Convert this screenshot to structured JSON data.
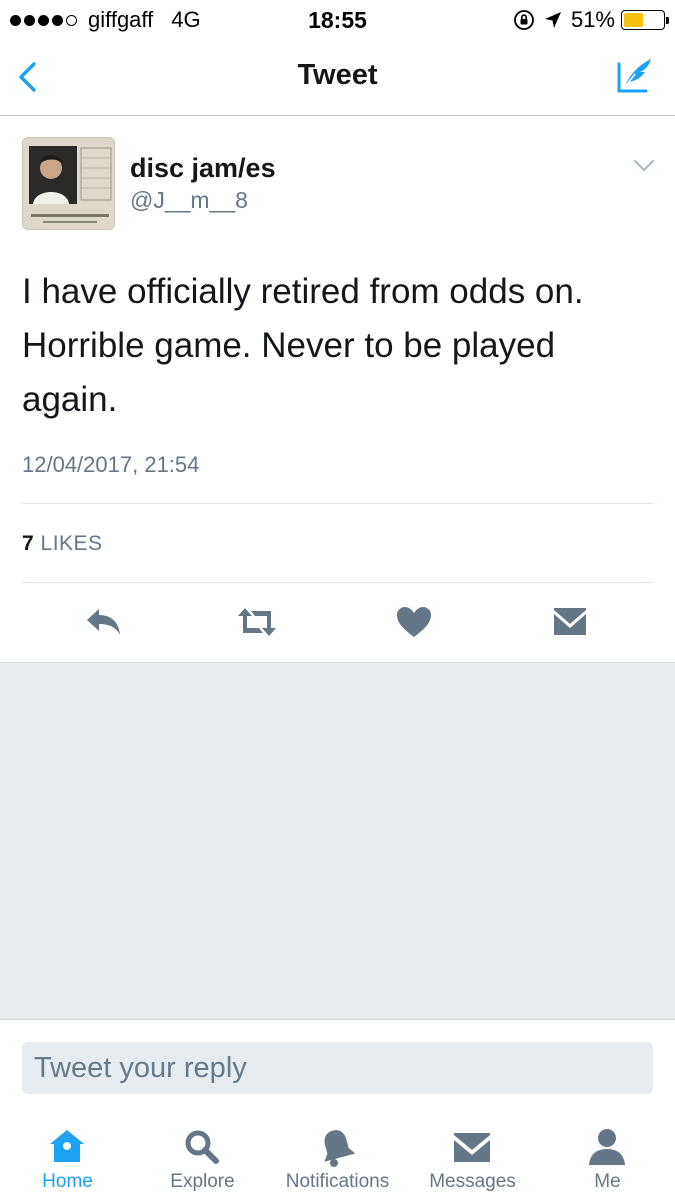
{
  "status_bar": {
    "carrier": "giffgaff",
    "network": "4G",
    "time": "18:55",
    "battery_percent": "51%",
    "battery_level": 0.51,
    "signal_bars": 4,
    "battery_color": "#f4c20d"
  },
  "nav": {
    "title": "Tweet",
    "back_icon": "chevron-left-icon",
    "compose_icon": "compose-tweet-icon",
    "accent_color": "#1da1f2"
  },
  "tweet": {
    "display_name": "disc jam/es",
    "handle": "@J__m__8",
    "text": "I have officially retired from odds on. Horrible game. Never to be played again.",
    "timestamp": "12/04/2017, 21:54",
    "likes_count": "7",
    "likes_label": "LIKES",
    "actions": [
      "reply-icon",
      "retweet-icon",
      "like-icon",
      "direct-message-icon"
    ]
  },
  "reply": {
    "placeholder": "Tweet your reply"
  },
  "tab_bar": {
    "active": "Home",
    "tabs": [
      {
        "label": "Home",
        "icon": "home-icon"
      },
      {
        "label": "Explore",
        "icon": "search-icon"
      },
      {
        "label": "Notifications",
        "icon": "bell-icon"
      },
      {
        "label": "Messages",
        "icon": "envelope-icon"
      },
      {
        "label": "Me",
        "icon": "person-icon"
      }
    ]
  }
}
